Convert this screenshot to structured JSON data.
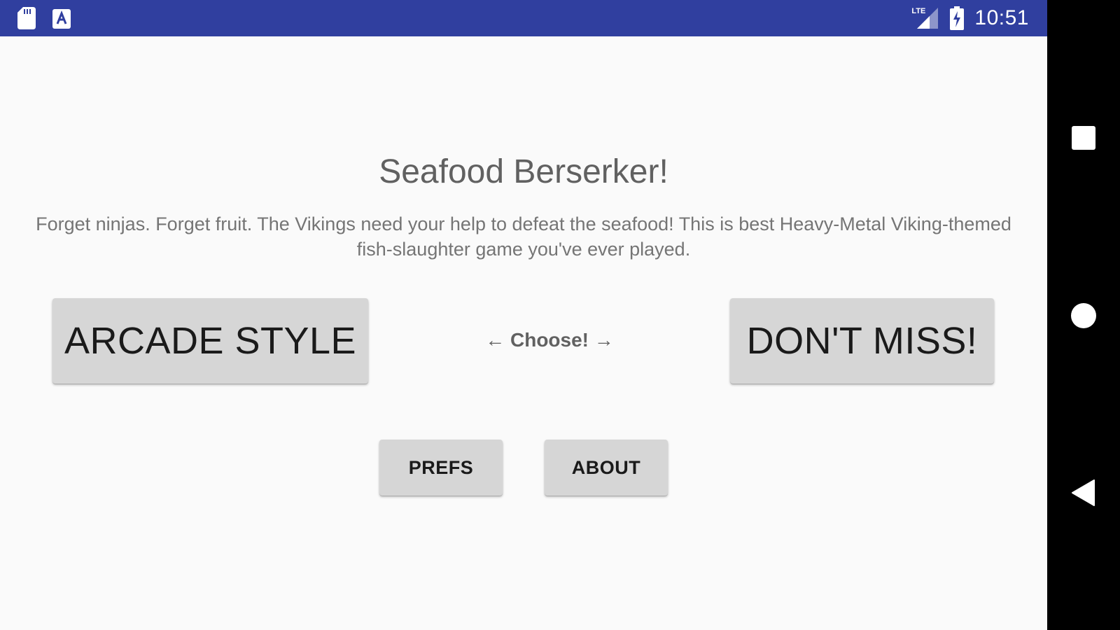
{
  "status_bar": {
    "time": "10:51",
    "network_label": "LTE",
    "icons": [
      "sd-card-icon",
      "app-notification-icon",
      "signal-icon",
      "battery-charging-icon"
    ],
    "background_color": "#303f9f"
  },
  "main": {
    "title": "Seafood Berserker!",
    "description": "Forget ninjas. Forget fruit. The Vikings need your help to defeat the seafood! This is best Heavy-Metal Viking-themed fish-slaughter game you've ever played.",
    "arcade_button_label": "ARCADE STYLE",
    "choose_label": "← Choose! →",
    "dont_miss_button_label": "DON'T MISS!",
    "prefs_button_label": "PREFS",
    "about_button_label": "ABOUT"
  },
  "nav_bar": {
    "buttons": [
      "recents-icon",
      "home-icon",
      "back-icon"
    ]
  }
}
